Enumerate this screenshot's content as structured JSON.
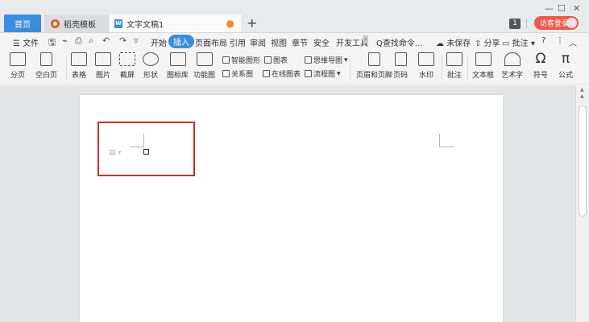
{
  "tabs": {
    "home": "首页",
    "templates": "稻壳模板",
    "document": "文字文稿1",
    "new_tab": "+"
  },
  "window": {
    "minimize": "—",
    "maximize": "☐",
    "close": "✕",
    "badge_count": "1",
    "login": "访客登录"
  },
  "menu": {
    "file": "☰ 文件",
    "items": [
      "开始",
      "插入",
      "页面布局",
      "引用",
      "审阅",
      "视图",
      "章节",
      "安全",
      "开发工具"
    ],
    "active": "插入",
    "search": "Q查找命令...",
    "unsaved": "未保存",
    "share": "分享",
    "comment": "批注",
    "help": "?"
  },
  "ribbon": {
    "page_break": "分页",
    "blank_page": "空白页",
    "table": "表格",
    "picture": "图片",
    "screenshot": "截屏",
    "shape": "形状",
    "icon_lib": "图标库",
    "function_chart": "功能图",
    "smart_art": "智能图形",
    "chart": "图表",
    "mind_map": "思维导图",
    "relation": "关系图",
    "online_chart": "在线图表",
    "flowchart": "流程图",
    "header_footer": "页眉和页脚",
    "page_num": "页码",
    "watermark": "水印",
    "comment": "批注",
    "textbox": "文本框",
    "word_art": "艺术字",
    "symbol": "符号",
    "formula": "公式"
  },
  "colors": {
    "accent": "#3c8dde",
    "login": "#e95a4f",
    "highlight": "#d42a2a"
  }
}
